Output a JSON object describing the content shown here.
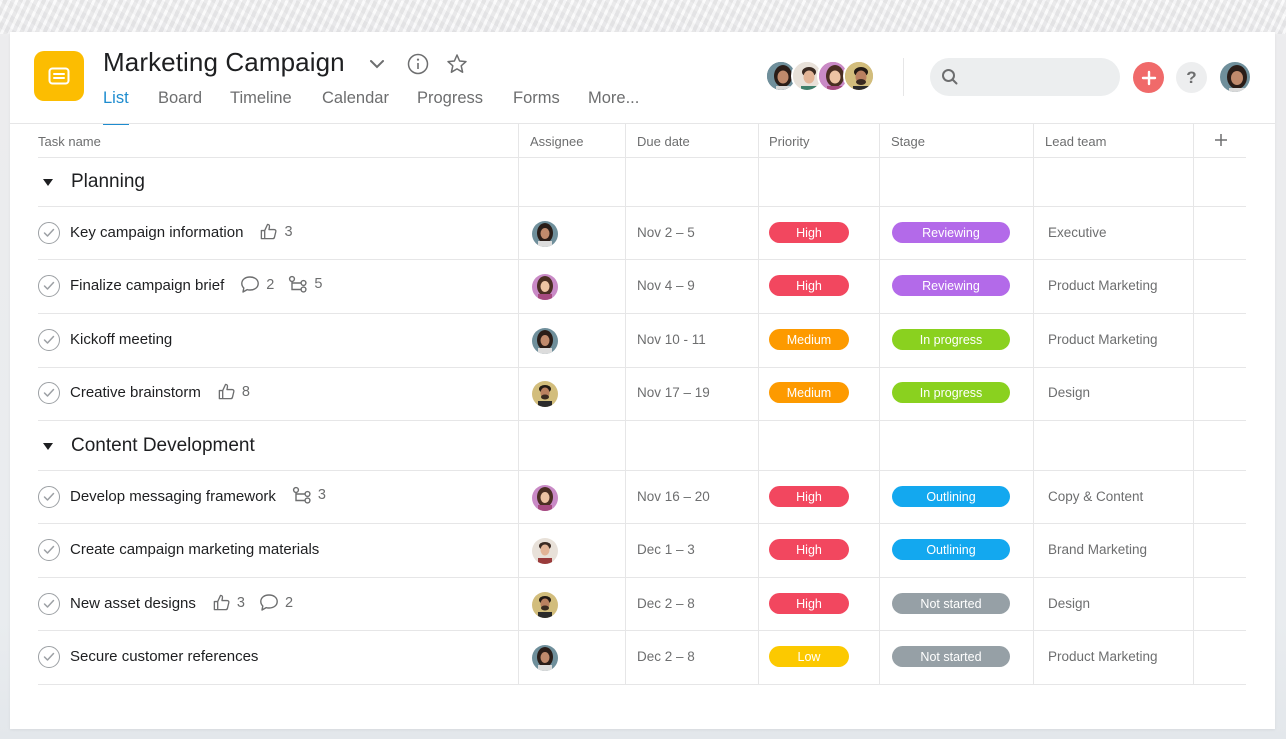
{
  "header": {
    "title": "Marketing Campaign",
    "tabs": [
      {
        "label": "List",
        "active": true
      },
      {
        "label": "Board"
      },
      {
        "label": "Timeline"
      },
      {
        "label": "Calendar"
      },
      {
        "label": "Progress"
      },
      {
        "label": "Forms"
      },
      {
        "label": "More..."
      }
    ],
    "search_placeholder": "",
    "help_label": "?"
  },
  "columns": {
    "task": "Task name",
    "assignee": "Assignee",
    "due": "Due date",
    "priority": "Priority",
    "stage": "Stage",
    "lead": "Lead team"
  },
  "colors": {
    "high": "#f2475f",
    "medium": "#fd9a00",
    "low": "#fcc900",
    "reviewing": "#b36ae9",
    "in_progress": "#8ad11f",
    "outlining": "#13a8ef",
    "not_started": "#96a0a6",
    "accent": "#1e8ccf",
    "app_icon": "#fcbd01"
  },
  "sections": [
    {
      "title": "Planning",
      "tasks": [
        {
          "name": "Key campaign information",
          "likes": "3",
          "assignee": "woman-dark-hair",
          "due": "Nov 2 – 5",
          "priority": "High",
          "stage": "Reviewing",
          "lead": "Executive"
        },
        {
          "name": "Finalize campaign brief",
          "comments": "2",
          "subtasks": "5",
          "assignee": "woman-pink-bg",
          "due": "Nov 4 – 9",
          "priority": "High",
          "stage": "Reviewing",
          "lead": "Product Marketing"
        },
        {
          "name": "Kickoff meeting",
          "assignee": "woman-dark-hair",
          "due": "Nov 10 - 11",
          "priority": "Medium",
          "stage": "In progress",
          "lead": "Product Marketing"
        },
        {
          "name": "Creative brainstorm",
          "likes": "8",
          "assignee": "man-beard",
          "due": "Nov 17 – 19",
          "priority": "Medium",
          "stage": "In progress",
          "lead": "Design"
        }
      ]
    },
    {
      "title": "Content Development",
      "tasks": [
        {
          "name": "Develop messaging framework",
          "subtasks": "3",
          "assignee": "woman-pink-bg",
          "due": "Nov 16 – 20",
          "priority": "High",
          "stage": "Outlining",
          "lead": "Copy & Content"
        },
        {
          "name": "Create campaign marketing materials",
          "assignee": "man-light",
          "due": "Dec 1 – 3",
          "priority": "High",
          "stage": "Outlining",
          "lead": "Brand Marketing"
        },
        {
          "name": "New asset designs",
          "likes": "3",
          "comments": "2",
          "assignee": "man-beard",
          "due": "Dec 2 – 8",
          "priority": "High",
          "stage": "Not started",
          "lead": "Design"
        },
        {
          "name": "Secure customer references",
          "assignee": "woman-dark-hair",
          "due": "Dec 2 – 8",
          "priority": "Low",
          "stage": "Not started",
          "lead": "Product Marketing"
        }
      ]
    }
  ]
}
